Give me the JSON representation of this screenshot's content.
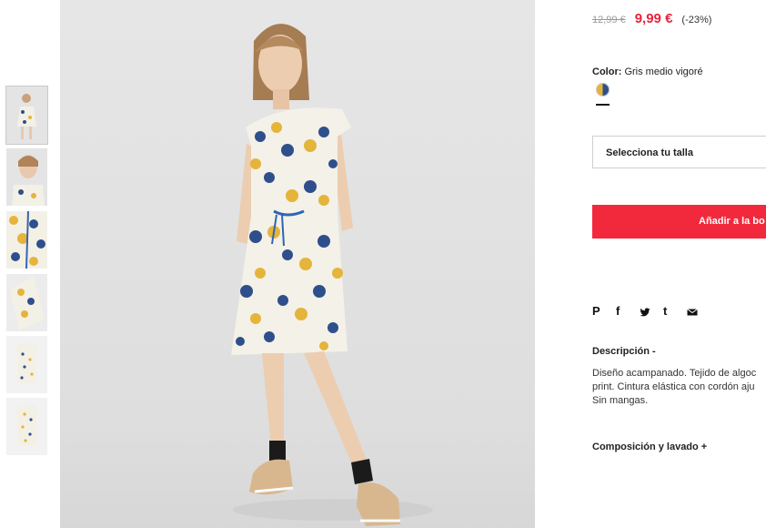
{
  "thumbnails": [
    {
      "alt": "thumb-full-model"
    },
    {
      "alt": "thumb-closeup"
    },
    {
      "alt": "thumb-pattern-detail"
    },
    {
      "alt": "thumb-sleeve-detail"
    },
    {
      "alt": "thumb-front"
    },
    {
      "alt": "thumb-back"
    }
  ],
  "price": {
    "original": "12,99 €",
    "sale": "9,99 €",
    "discount": "(-23%)"
  },
  "color": {
    "label": "Color:",
    "value": "Gris medio vigoré"
  },
  "size": {
    "placeholder": "Selecciona tu talla"
  },
  "add_to_bag": {
    "label": "Añadir a la bo"
  },
  "share": {
    "pinterest": "P",
    "facebook": "f",
    "tumblr": "t"
  },
  "description": {
    "title": "Descripción -",
    "lines": [
      "Diseño acampanado. Tejido de algoc",
      "print. Cintura elástica con cordón aju",
      "Sin mangas."
    ]
  },
  "composition": {
    "title": "Composición y lavado +"
  },
  "colors": {
    "sale": "#e8243c",
    "button": "#f2293d",
    "print_blue": "#2e4f8c",
    "print_yellow": "#e5b43a"
  }
}
